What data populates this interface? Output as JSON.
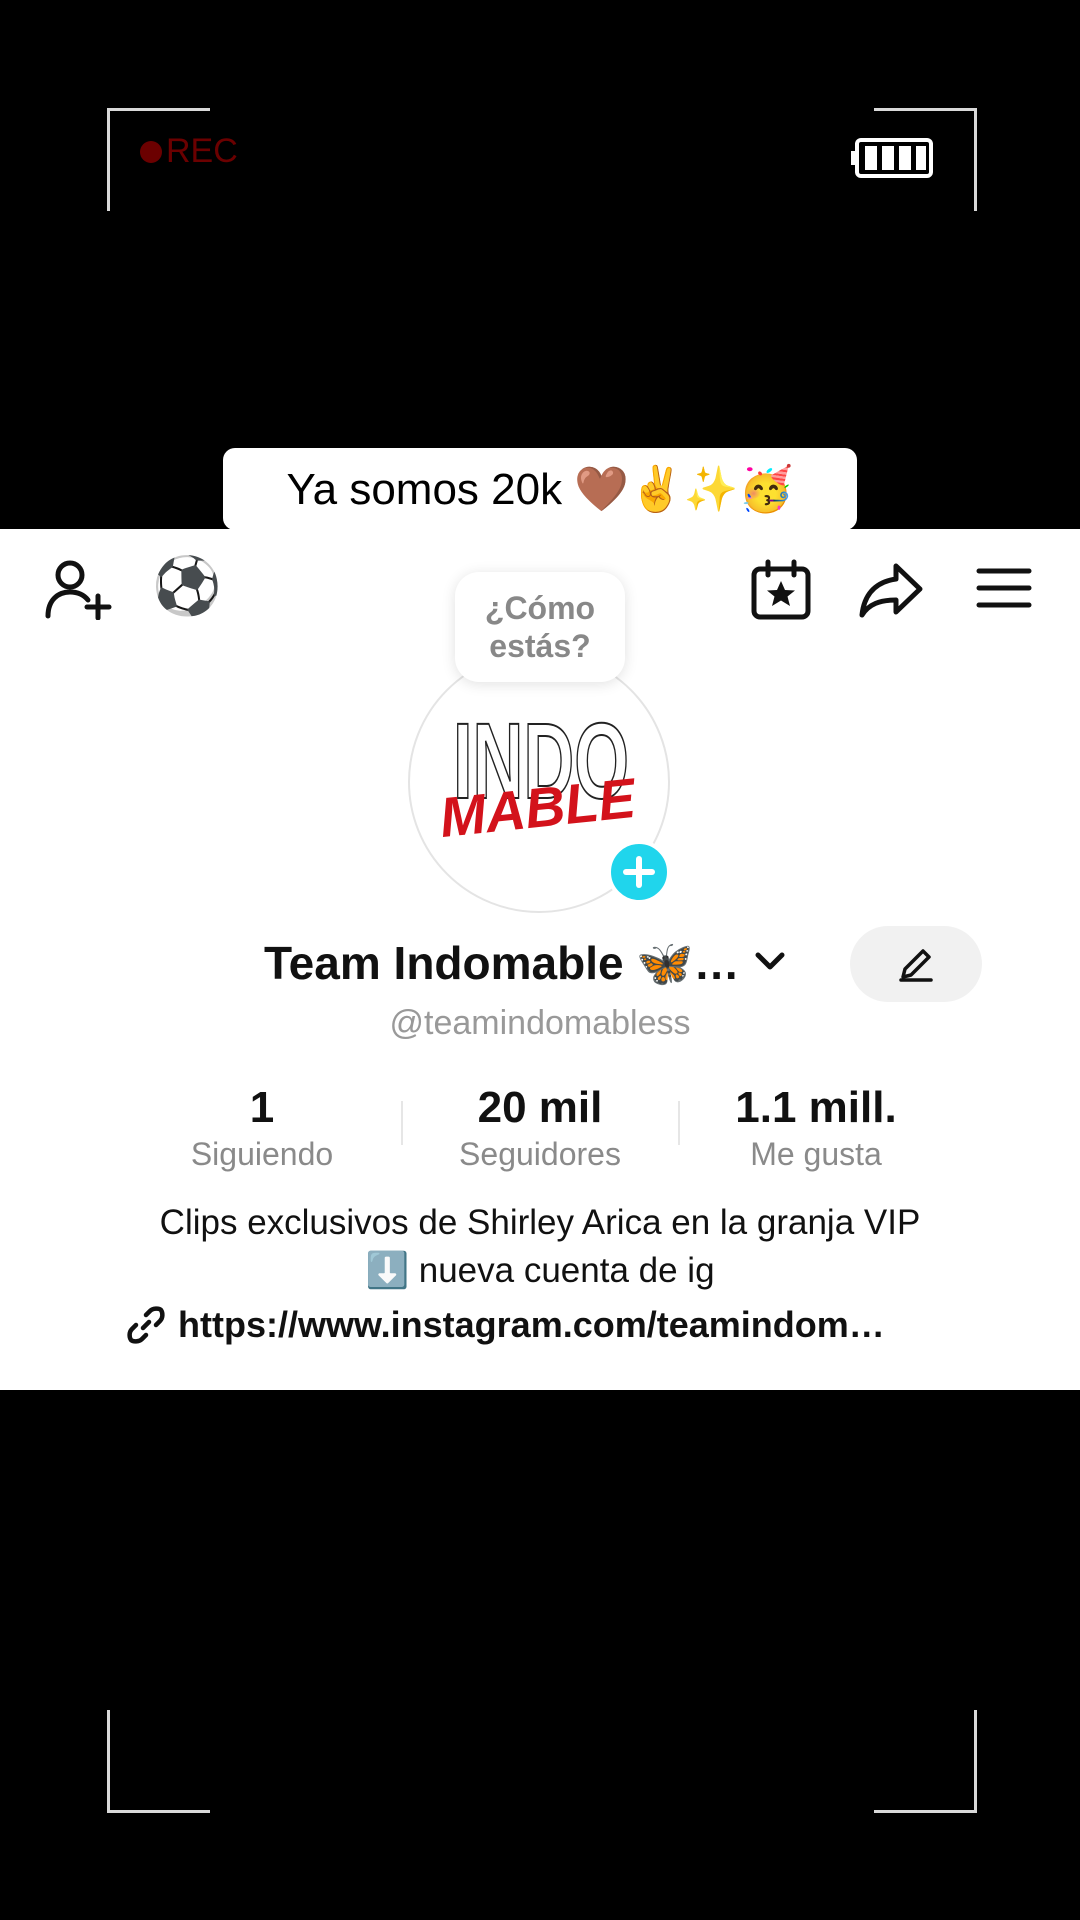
{
  "overlay": {
    "rec_label": "REC",
    "caption": "Ya somos 20k 🤎✌️✨🥳"
  },
  "profile": {
    "soccer_emoji": "⚽",
    "bubble_text": "¿Cómo estás?",
    "display_name": "Team Indomable 🦋…",
    "username": "@teamindomabless",
    "avatar_logo": {
      "top": "INDO",
      "bottom": "MABLE"
    },
    "stats": [
      {
        "value": "1",
        "label": "Siguiendo"
      },
      {
        "value": "20 mil",
        "label": "Seguidores"
      },
      {
        "value": "1.1 mill.",
        "label": "Me gusta"
      }
    ],
    "bio_line1": "Clips exclusivos de Shirley Arica en la granja VIP",
    "bio_line2": "⬇️ nueva cuenta de ig",
    "link": "https://www.instagram.com/teamindom…"
  },
  "colors": {
    "accent": "#20d5ec",
    "rec": "#6b0000",
    "logo_red": "#d3121b"
  }
}
